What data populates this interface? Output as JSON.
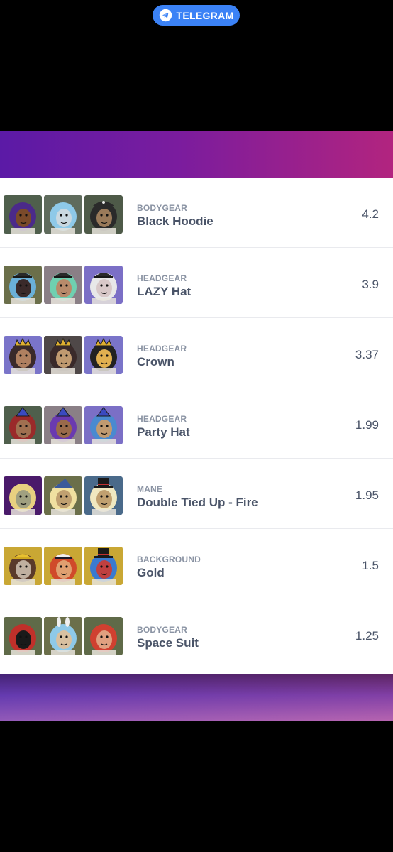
{
  "header": {
    "telegram_label": "TELEGRAM"
  },
  "traits": [
    {
      "category": "BODYGEAR",
      "name": "Black Hoodie",
      "score": "4.2",
      "thumbs": [
        {
          "bg": "#4f5f4c",
          "mane": "#4b2a8a",
          "face": "#7a4a2a",
          "hat": "none"
        },
        {
          "bg": "#5f6b5c",
          "mane": "#8ec9e8",
          "face": "#c9d8e0",
          "hat": "none"
        },
        {
          "bg": "#4e5a48",
          "mane": "#2a2a2a",
          "face": "#9a7a5a",
          "hat": "pirate"
        }
      ]
    },
    {
      "category": "HEADGEAR",
      "name": "LAZY Hat",
      "score": "3.9",
      "thumbs": [
        {
          "bg": "#6b6f4a",
          "mane": "#6ab0d8",
          "face": "#3a2a2a",
          "hat": "cap"
        },
        {
          "bg": "#8a7f86",
          "mane": "#6fd0b0",
          "face": "#b88a6a",
          "hat": "cap"
        },
        {
          "bg": "#7b6fc6",
          "mane": "#e8e8e8",
          "face": "#d8c8c8",
          "hat": "cap"
        }
      ]
    },
    {
      "category": "HEADGEAR",
      "name": "Crown",
      "score": "3.37",
      "thumbs": [
        {
          "bg": "#7a74c9",
          "mane": "#3a2a2a",
          "face": "#b08060",
          "hat": "crown"
        },
        {
          "bg": "#4f4848",
          "mane": "#3a2a2a",
          "face": "#c09a70",
          "hat": "crown"
        },
        {
          "bg": "#7a74c9",
          "mane": "#222222",
          "face": "#e0b050",
          "hat": "crown"
        }
      ]
    },
    {
      "category": "HEADGEAR",
      "name": "Party Hat",
      "score": "1.99",
      "thumbs": [
        {
          "bg": "#4f5f4c",
          "mane": "#9a2a2a",
          "face": "#a07050",
          "hat": "party"
        },
        {
          "bg": "#8a7f86",
          "mane": "#6a3ab0",
          "face": "#9a6a4a",
          "hat": "party"
        },
        {
          "bg": "#7b6fc6",
          "mane": "#4a8ad0",
          "face": "#c09a70",
          "hat": "party"
        }
      ]
    },
    {
      "category": "MANE",
      "name": "Double Tied Up - Fire",
      "score": "1.95",
      "thumbs": [
        {
          "bg": "#4a1a6a",
          "mane": "#e8d080",
          "face": "#a0a080",
          "hat": "none"
        },
        {
          "bg": "#6b6f4a",
          "mane": "#f0e0a0",
          "face": "#c0a070",
          "hat": "wizard"
        },
        {
          "bg": "#4a6a8a",
          "mane": "#f0e8c0",
          "face": "#c0a070",
          "hat": "tophat"
        }
      ]
    },
    {
      "category": "BACKGROUND",
      "name": "Gold",
      "score": "1.5",
      "thumbs": [
        {
          "bg": "#c9a734",
          "mane": "#5a3a2a",
          "face": "#c0b0a0",
          "hat": "hardhat"
        },
        {
          "bg": "#c9a734",
          "mane": "#d04a2a",
          "face": "#e0a070",
          "hat": "captain"
        },
        {
          "bg": "#c9a734",
          "mane": "#3a7ad0",
          "face": "#c04040",
          "hat": "tophat"
        }
      ]
    },
    {
      "category": "BODYGEAR",
      "name": "Space Suit",
      "score": "1.25",
      "thumbs": [
        {
          "bg": "#5f6a48",
          "mane": "#c0302a",
          "face": "#1a1a1a",
          "hat": "none"
        },
        {
          "bg": "#6b6f4a",
          "mane": "#8ec9e8",
          "face": "#d8c0a0",
          "hat": "bunny"
        },
        {
          "bg": "#5f6a48",
          "mane": "#d04030",
          "face": "#e0a080",
          "hat": "none"
        }
      ]
    }
  ]
}
